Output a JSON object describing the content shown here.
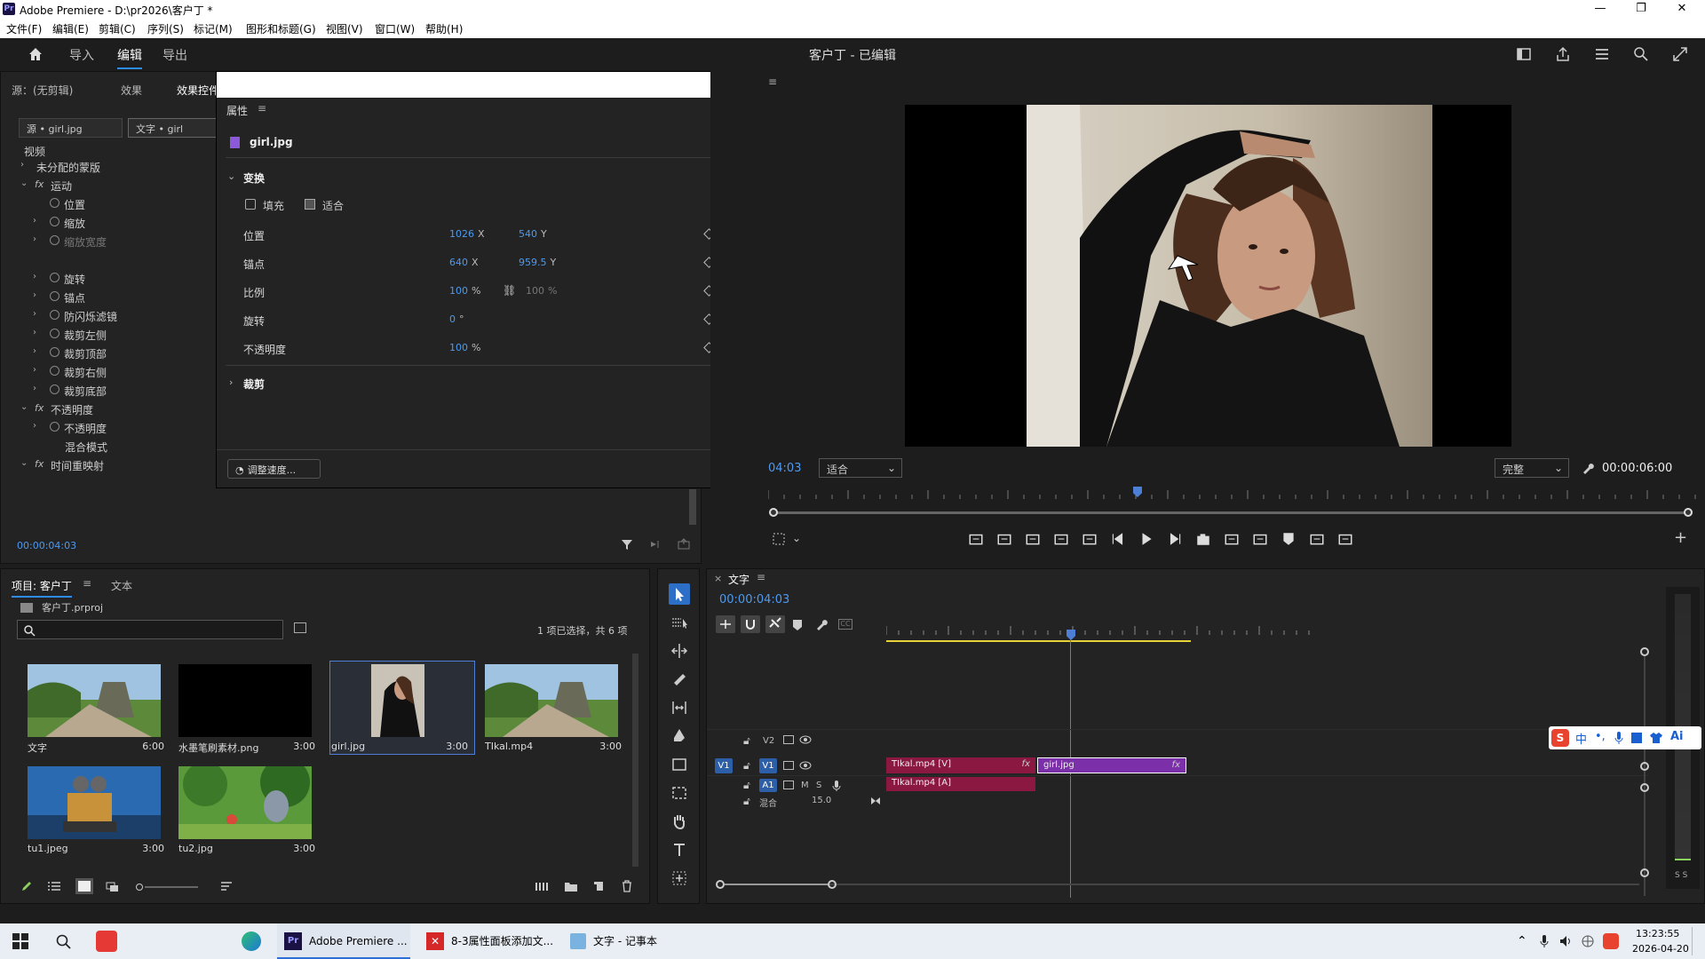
{
  "window": {
    "title": "Adobe Premiere - D:\\pr2026\\客户丁 *",
    "logo": "Pr"
  },
  "menu": [
    "文件(F)",
    "编辑(E)",
    "剪辑(C)",
    "序列(S)",
    "标记(M)",
    "图形和标题(G)",
    "视图(V)",
    "窗口(W)",
    "帮助(H)"
  ],
  "header": {
    "tabs": [
      "导入",
      "编辑",
      "导出"
    ],
    "active_tab": "编辑",
    "project_status": "客户丁 - 已编辑"
  },
  "left_panel": {
    "tabs": [
      "源：(无剪辑)",
      "效果",
      "效果控件"
    ],
    "chips": [
      "源 • girl.jpg",
      "文字 • girl"
    ],
    "section": "视频",
    "rows": [
      {
        "label": "未分配的蒙版",
        "indent": 0,
        "fx": false
      },
      {
        "label": "运动",
        "indent": 0,
        "fx": true
      },
      {
        "label": "位置",
        "indent": 1,
        "fx": false
      },
      {
        "label": "缩放",
        "indent": 1,
        "fx": false
      },
      {
        "label": "缩放宽度",
        "indent": 1,
        "fx": false
      },
      {
        "label": "",
        "indent": 1,
        "fx": false
      },
      {
        "label": "旋转",
        "indent": 1,
        "fx": false
      },
      {
        "label": "锚点",
        "indent": 1,
        "fx": false
      },
      {
        "label": "防闪烁滤镜",
        "indent": 1,
        "fx": false
      },
      {
        "label": "裁剪左侧",
        "indent": 1,
        "fx": false
      },
      {
        "label": "裁剪顶部",
        "indent": 1,
        "fx": false
      },
      {
        "label": "裁剪右侧",
        "indent": 1,
        "fx": false
      },
      {
        "label": "裁剪底部",
        "indent": 1,
        "fx": false
      },
      {
        "label": "不透明度",
        "indent": 0,
        "fx": true
      },
      {
        "label": "不透明度",
        "indent": 1,
        "fx": false
      },
      {
        "label": "混合模式",
        "indent": 1,
        "fx": false
      },
      {
        "label": "时间重映射",
        "indent": 0,
        "fx": true
      }
    ],
    "timecode": "00:00:04:03"
  },
  "properties": {
    "title": "属性",
    "file": "girl.jpg",
    "section": "变换",
    "fill_label": "填充",
    "fit_label": "适合",
    "rows": [
      {
        "label": "位置",
        "v1": "1026",
        "u1": "X",
        "v2": "540",
        "u2": "Y"
      },
      {
        "label": "锚点",
        "v1": "640",
        "u1": "X",
        "v2": "959.5",
        "u2": "Y"
      },
      {
        "label": "比例",
        "v1": "100",
        "u1": "%",
        "v2": "100",
        "u2": "%"
      },
      {
        "label": "旋转",
        "v1": "0",
        "u1": "°",
        "v2": "",
        "u2": ""
      },
      {
        "label": "不透明度",
        "v1": "100",
        "u1": "%",
        "v2": "",
        "u2": ""
      }
    ],
    "crop_label": "裁剪",
    "speed_button": "调整速度..."
  },
  "program": {
    "timecode": "04:03",
    "fit": "适合",
    "quality": "完整",
    "duration": "00:00:06:00"
  },
  "project": {
    "tabs": [
      "项目: 客户丁",
      "文本"
    ],
    "file": "客户丁.prproj",
    "selection": "1 项已选择，共 6 项",
    "items": [
      {
        "name": "文字",
        "dur": "6:00",
        "kind": "temple"
      },
      {
        "name": "水墨笔刷素材.png",
        "dur": "3:00",
        "kind": "black"
      },
      {
        "name": "girl.jpg",
        "dur": "3:00",
        "kind": "girl"
      },
      {
        "name": "TIkal.mp4",
        "dur": "3:00",
        "kind": "temple"
      },
      {
        "name": "tu1.jpeg",
        "dur": "3:00",
        "kind": "robot"
      },
      {
        "name": "tu2.jpg",
        "dur": "3:00",
        "kind": "forest"
      }
    ]
  },
  "timeline": {
    "tab": "文字",
    "timecode": "00:00:04:03",
    "tracks": {
      "v2": "V2",
      "v1": "V1",
      "a1": "A1",
      "mix": "混合",
      "mix_value": "15.0",
      "m": "M",
      "s": "S"
    },
    "clips": {
      "v1a": "TIkal.mp4 [V]",
      "v1b": "girl.jpg",
      "a1": "TIkal.mp4 [A]",
      "fx": "fx"
    },
    "meter_label": "S S"
  },
  "ime": {
    "items": [
      "中",
      "•,",
      "🎤",
      "▦",
      "👕",
      "Ai"
    ]
  },
  "taskbar": {
    "apps": [
      "Adobe Premiere ...",
      "8-3属性面板添加文...",
      "文字 - 记事本"
    ],
    "time": "13:23:55",
    "date": "2026-04-20"
  },
  "colors": {
    "accent": "#2d8ceb",
    "clip_video": "#8a1840",
    "clip_selected": "#7b2fa8",
    "clip_audio": "#8a1840"
  }
}
